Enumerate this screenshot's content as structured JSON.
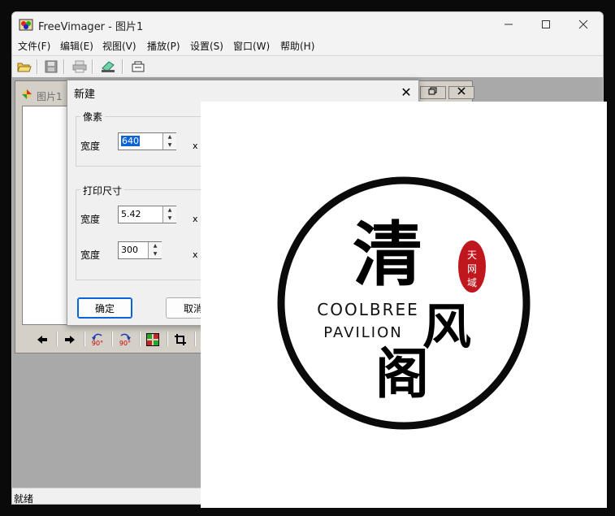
{
  "app": {
    "title": "FreeVimager - 图片1"
  },
  "menu": {
    "items": [
      "文件(F)",
      "编辑(E)",
      "视图(V)",
      "播放(P)",
      "设置(S)",
      "窗口(W)",
      "帮助(H)"
    ]
  },
  "toolbar": {
    "icons": [
      "open-icon",
      "save-icon",
      "print-icon",
      "scan-icon",
      "capture-icon"
    ]
  },
  "child_window": {
    "title": "图片1",
    "tools": {
      "rotate_ccw": "90°",
      "rotate_cw": "90°"
    }
  },
  "dialog": {
    "title": "新建",
    "close_glyph": "✕",
    "pixel_group": {
      "title": "像素",
      "width_label": "宽度",
      "width_value": "640",
      "times": "x"
    },
    "print_group": {
      "title": "打印尺寸",
      "width_label": "宽度",
      "width_value": "5.42",
      "dpi_label": "宽度",
      "dpi_value": "300",
      "times": "x"
    },
    "ok_label": "确定",
    "cancel_label": "取消"
  },
  "overlay_logo": {
    "char_top": "清",
    "char_mid": "风",
    "char_bottom": "阁",
    "line1": "COOLBREE",
    "line2": "PAVILION",
    "seal_chars": [
      "天",
      "网",
      "域"
    ],
    "seal_color": "#c0171e"
  },
  "status": {
    "text": "就绪"
  }
}
